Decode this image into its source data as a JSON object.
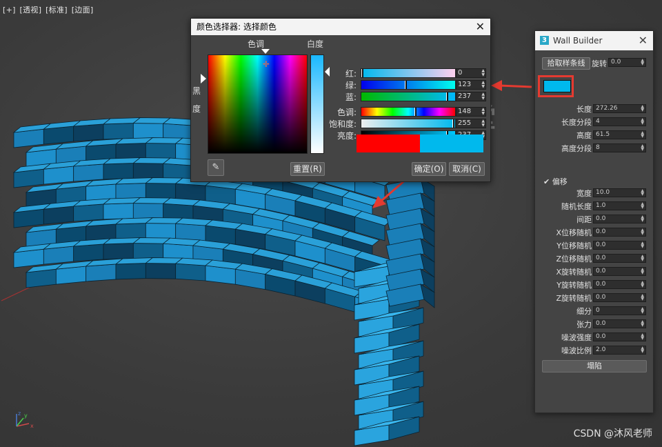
{
  "viewport": {
    "labels": [
      "[+]",
      "[透视]",
      "[标准]",
      "[边面]"
    ],
    "watermark": "沐风课堂",
    "credit": "CSDN @沐风老师",
    "axis": {
      "x": "x",
      "y": "y",
      "z": "z"
    }
  },
  "color_picker": {
    "title": "颜色选择器: 选择颜色",
    "close": "✕",
    "hue_label": "色调",
    "white_label": "白度",
    "black_label": "黑度",
    "eyedropper_icon": "eyedropper-icon",
    "reset_label": "重置(R)",
    "ok_label": "确定(O)",
    "cancel_label": "取消(C)",
    "old_color": "#ff0000",
    "new_color": "#00b9ed",
    "rows": [
      {
        "label": "红:",
        "value": "0",
        "fraction": 0.0
      },
      {
        "label": "绿:",
        "value": "123",
        "fraction": 0.48
      },
      {
        "label": "蓝:",
        "value": "237",
        "fraction": 0.93
      },
      {
        "label": "色调:",
        "value": "148",
        "fraction": 0.58
      },
      {
        "label": "饱和度:",
        "value": "255",
        "fraction": 1.0
      },
      {
        "label": "亮度:",
        "value": "237",
        "fraction": 0.93
      }
    ]
  },
  "wall_builder": {
    "title": "Wall Builder",
    "close": "✕",
    "pick_spline": "拾取样条线",
    "rotation_label": "旋转",
    "rotation_value": "0.0",
    "color": "#00b9ed",
    "offset_checkbox": "偏移",
    "collapse": "塌陷",
    "params_top": [
      {
        "label": "长度",
        "value": "272.26"
      },
      {
        "label": "长度分段",
        "value": "4"
      },
      {
        "label": "高度",
        "value": "61.5"
      },
      {
        "label": "高度分段",
        "value": "8"
      }
    ],
    "params_bottom": [
      {
        "label": "宽度",
        "value": "10.0"
      },
      {
        "label": "随机长度",
        "value": "1.0"
      },
      {
        "label": "间距",
        "value": "0.0"
      },
      {
        "label": "X位移随机",
        "value": "0.0"
      },
      {
        "label": "Y位移随机",
        "value": "0.0"
      },
      {
        "label": "Z位移随机",
        "value": "0.0"
      },
      {
        "label": "X旋转随机",
        "value": "0.0"
      },
      {
        "label": "Y旋转随机",
        "value": "0.0"
      },
      {
        "label": "Z旋转随机",
        "value": "0.0"
      },
      {
        "label": "细分",
        "value": "0"
      },
      {
        "label": "张力",
        "value": "0.0"
      },
      {
        "label": "噪波强度",
        "value": "0.0"
      },
      {
        "label": "噪波比例",
        "value": "2.0"
      }
    ]
  }
}
